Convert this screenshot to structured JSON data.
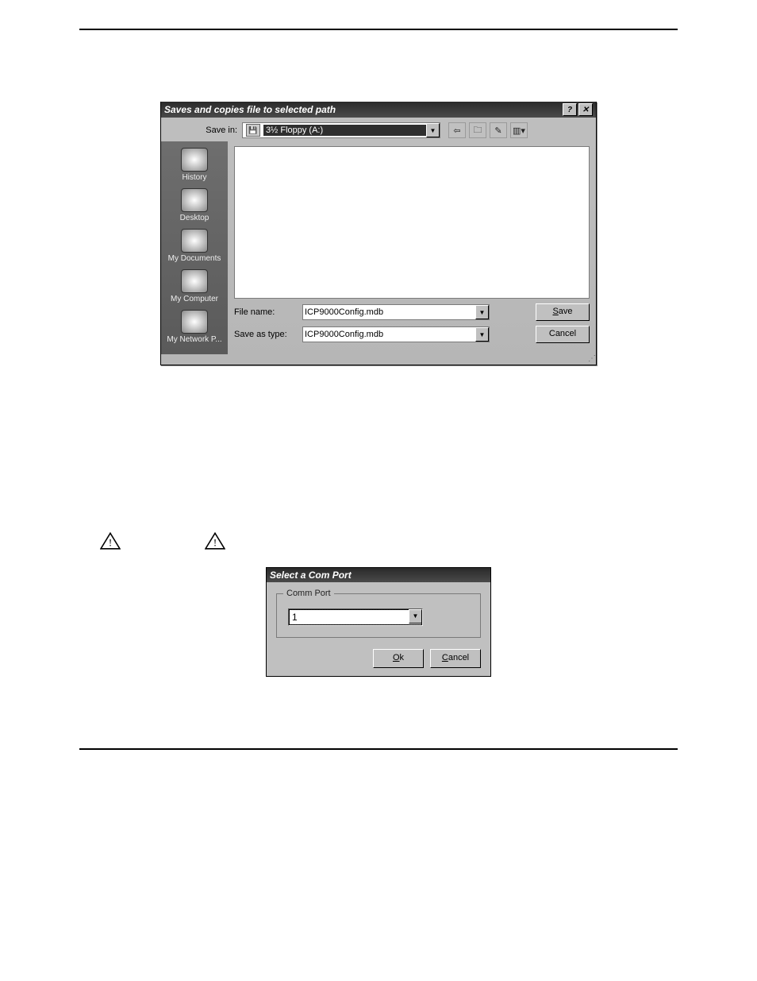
{
  "saveas": {
    "title": "Saves and copies file to selected path",
    "help_btn": "?",
    "close_btn": "✕",
    "save_in_label": "Save in:",
    "save_in_value": "3½ Floppy (A:)",
    "toolbar": {
      "back": "⇦",
      "up": "🗀",
      "newfolder": "✎",
      "views": "▥▾"
    },
    "places": {
      "history": "History",
      "desktop": "Desktop",
      "mydocs": "My Documents",
      "mycomp": "My Computer",
      "mynet": "My Network P..."
    },
    "filename_label": "File name:",
    "filename_value": "ICP9000Config.mdb",
    "saveastype_label": "Save as type:",
    "saveastype_value": "ICP9000Config.mdb",
    "save_btn_pre": "",
    "save_btn_ul": "S",
    "save_btn_post": "ave",
    "cancel_btn": "Cancel"
  },
  "comport": {
    "title": "Select a Com Port",
    "group_legend": "Comm Port",
    "value": "1",
    "ok_pre": "",
    "ok_ul": "O",
    "ok_post": "k",
    "cancel_pre": "",
    "cancel_ul": "C",
    "cancel_post": "ancel"
  }
}
